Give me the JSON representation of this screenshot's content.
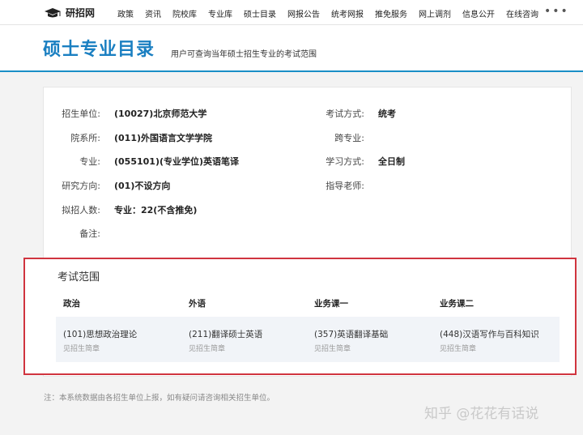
{
  "topnav": {
    "logo": "研招网",
    "items": [
      "政策",
      "资讯",
      "院校库",
      "专业库",
      "硕士目录",
      "网报公告",
      "统考网报",
      "推免服务",
      "网上调剂",
      "信息公开",
      "在线咨询"
    ],
    "more": "•••"
  },
  "banner": {
    "title": "硕士专业目录",
    "subtitle": "用户可查询当年硕士招生专业的考试范围"
  },
  "info": {
    "unit_label": "招生单位:",
    "unit_value": "(10027)北京师范大学",
    "dept_label": "院系所:",
    "dept_value": "(011)外国语言文学学院",
    "major_label": "专业:",
    "major_value": "(055101)(专业学位)英语笔译",
    "direction_label": "研究方向:",
    "direction_value": "(01)不设方向",
    "quota_label": "拟招人数:",
    "quota_value": "专业：22(不含推免)",
    "remark_label": "备注:",
    "exam_mode_label": "考试方式:",
    "exam_mode_value": "统考",
    "cross_label": "跨专业:",
    "study_mode_label": "学习方式:",
    "study_mode_value": "全日制",
    "advisor_label": "指导老师:"
  },
  "exam": {
    "title": "考试范围",
    "columns": [
      {
        "head": "政治",
        "subject": "(101)思想政治理论",
        "note": "见招生简章"
      },
      {
        "head": "外语",
        "subject": "(211)翻译硕士英语",
        "note": "见招生简章"
      },
      {
        "head": "业务课一",
        "subject": "(357)英语翻译基础",
        "note": "见招生简章"
      },
      {
        "head": "业务课二",
        "subject": "(448)汉语写作与百科知识",
        "note": "见招生简章"
      }
    ]
  },
  "footnote": "注：本系统数据由各招生单位上报，如有疑问请咨询相关招生单位。",
  "watermark": "知乎 @花花有话说"
}
